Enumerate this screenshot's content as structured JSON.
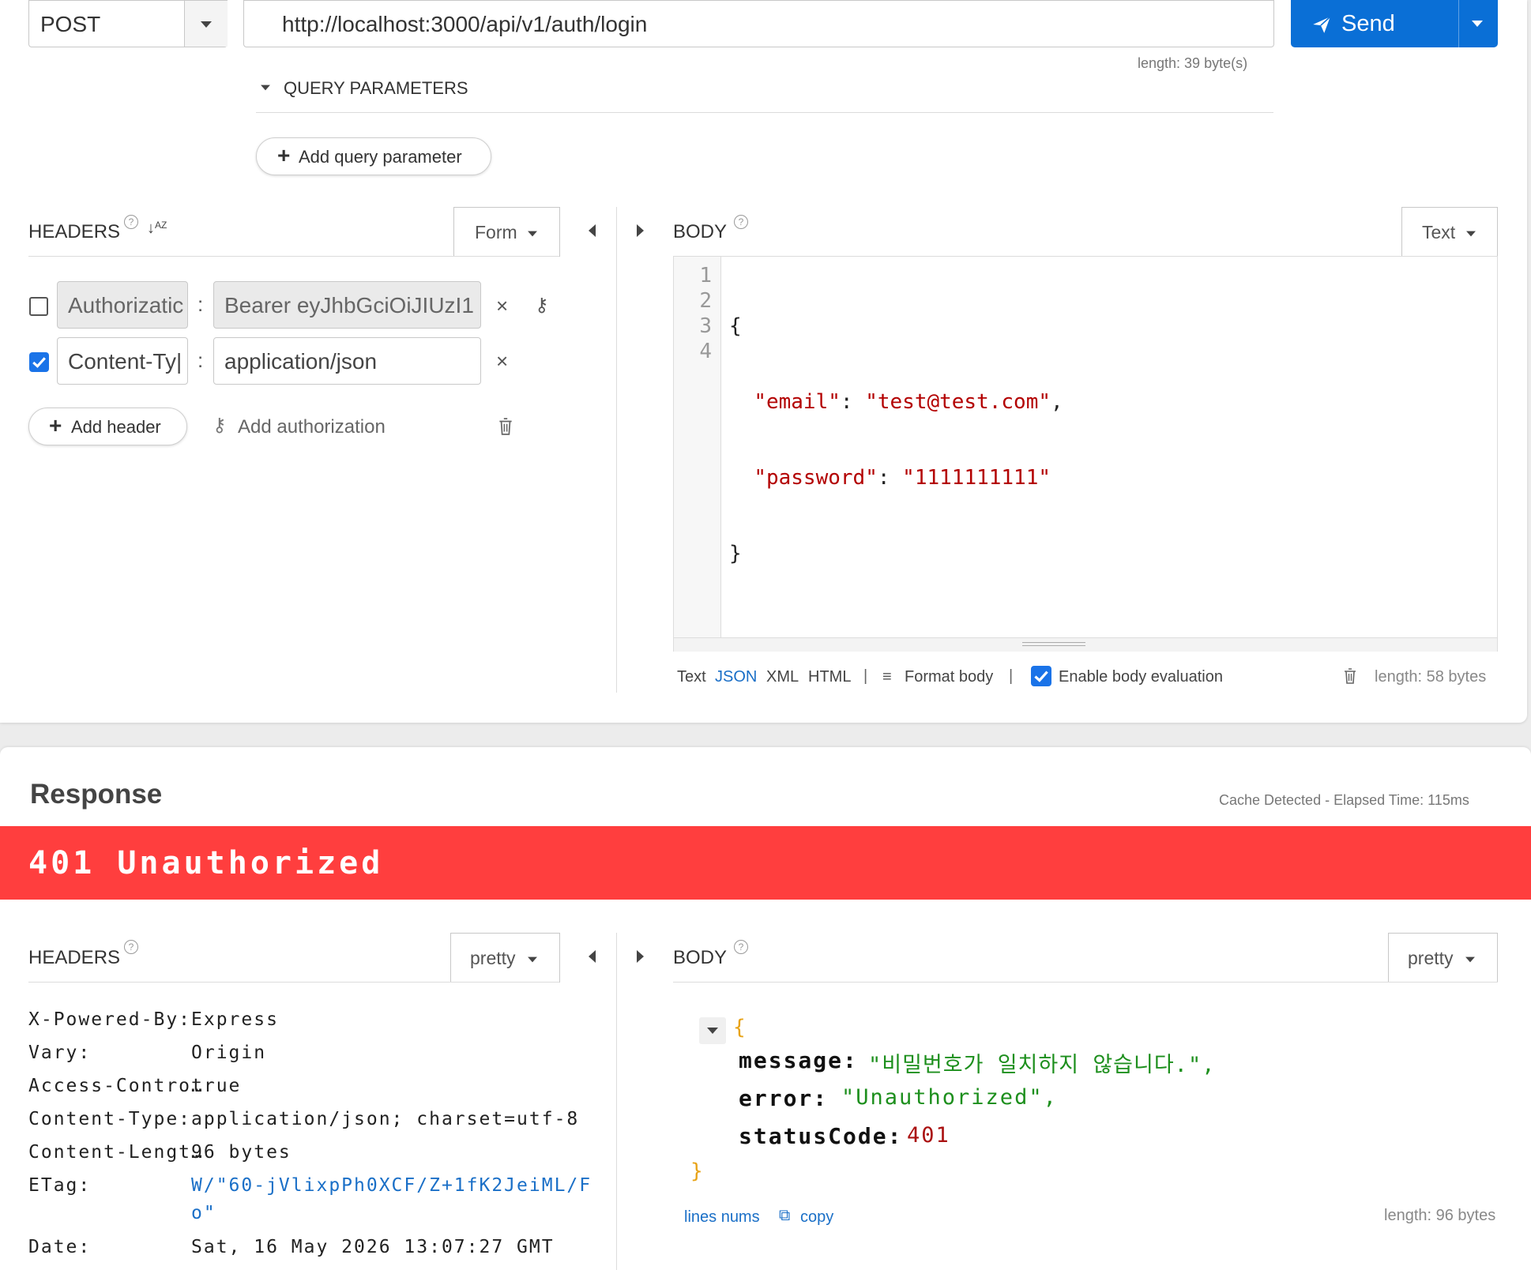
{
  "request": {
    "method": "POST",
    "url": "http://localhost:3000/api/v1/auth/login",
    "send_label": "Send",
    "url_length": "length: 39 byte(s)",
    "query_params_label": "QUERY PARAMETERS",
    "add_query_param_label": "Add query parameter",
    "headers_label": "HEADERS",
    "headers_mode": "Form",
    "headers": [
      {
        "enabled": false,
        "name": "Authorizatic",
        "value": "Bearer eyJhbGciOiJIUzI1"
      },
      {
        "enabled": true,
        "name": "Content-Ty|",
        "value": "application/json"
      }
    ],
    "add_header_label": "Add header",
    "add_auth_label": "Add authorization",
    "body_label": "BODY",
    "body_mode": "Text",
    "body_lines": [
      "1",
      "2",
      "3",
      "4"
    ],
    "body_code": {
      "open": "{",
      "email_key": "\"email\"",
      "email_value": "\"test@test.com\"",
      "password_key": "\"password\"",
      "password_value": "\"1111111111\"",
      "close": "}"
    },
    "body_formats": {
      "text": "Text",
      "json": "JSON",
      "xml": "XML",
      "html": "HTML"
    },
    "format_body_label": "Format body",
    "enable_eval_label": "Enable body evaluation",
    "body_length": "length: 58 bytes"
  },
  "response": {
    "title": "Response",
    "cache_info": "Cache Detected - Elapsed Time: 115ms",
    "status_text": "401 Unauthorized",
    "status_color": "#ff3e3e",
    "headers_label": "HEADERS",
    "headers_mode": "pretty",
    "headers": [
      {
        "name": "X-Powered-By:",
        "value": "Express"
      },
      {
        "name": "Vary:",
        "value": "Origin"
      },
      {
        "name": "Access-Contro…",
        "value": "true"
      },
      {
        "name": "Content-Type:",
        "value": "application/json; charset=utf-8"
      },
      {
        "name": "Content-Lengt…",
        "value": "96 bytes"
      },
      {
        "name": "ETag:",
        "value": "W/\"60-jVlixpPh0XCF/Z+1fK2JeiML/F",
        "value2": "o\""
      },
      {
        "name": "Date:",
        "value": "Sat, 16 May 2026 13:07:27 GMT"
      }
    ],
    "body_label": "BODY",
    "body_mode": "pretty",
    "json": {
      "open": "{",
      "close": "}",
      "message_key": "message:",
      "message_value": "\"비밀번호가 일치하지 않습니다.\",",
      "error_key": "error:",
      "error_value": "\"Unauthorized\",",
      "status_key": "statusCode:",
      "status_value": "401"
    },
    "lines_nums_label": "lines nums",
    "copy_label": "copy",
    "body_length": "length: 96 bytes"
  },
  "colors": {
    "accent": "#0a6fd6",
    "string_red": "#b30000",
    "json_green": "#1d8f1d",
    "brace_orange": "#e8a317",
    "link_blue": "#1a6fc7"
  }
}
